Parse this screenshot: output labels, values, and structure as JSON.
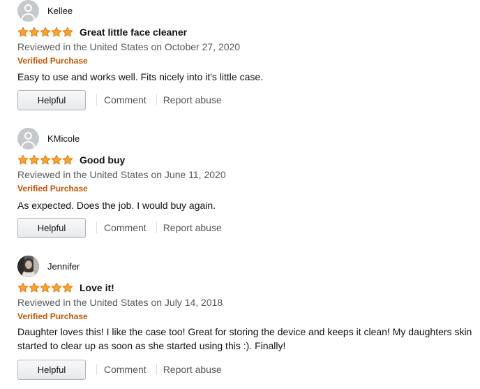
{
  "reviews": [
    {
      "author": "Kellee",
      "avatar": "default-avatar",
      "rating": 5,
      "title": "Great little face cleaner",
      "date_text": "Reviewed in the United States on October 27, 2020",
      "verified": "Verified Purchase",
      "body": "Easy to use and works well. Fits nicely into it's little case.",
      "helpful_label": "Helpful",
      "comment_label": "Comment",
      "report_label": "Report abuse"
    },
    {
      "author": "KMicole",
      "avatar": "default-avatar",
      "rating": 5,
      "title": "Good buy",
      "date_text": "Reviewed in the United States on June 11, 2020",
      "verified": "Verified Purchase",
      "body": "As expected. Does the job. I would buy again.",
      "helpful_label": "Helpful",
      "comment_label": "Comment",
      "report_label": "Report abuse"
    },
    {
      "author": "Jennifer",
      "avatar": "photo-avatar",
      "rating": 5,
      "title": "Love it!",
      "date_text": "Reviewed in the United States on July 14, 2018",
      "verified": "Verified Purchase",
      "body": "Daughter loves this! I like the case too! Great for storing the device and keeps it clean! My daughters skin started to clear up as soon as she started using this :). Finally!",
      "helpful_label": "Helpful",
      "comment_label": "Comment",
      "report_label": "Report abuse"
    }
  ],
  "colors": {
    "star_fill": "#ffa41c",
    "star_stroke": "#de7921",
    "verified": "#c45500",
    "secondary_text": "#565959",
    "link": "#555555"
  }
}
